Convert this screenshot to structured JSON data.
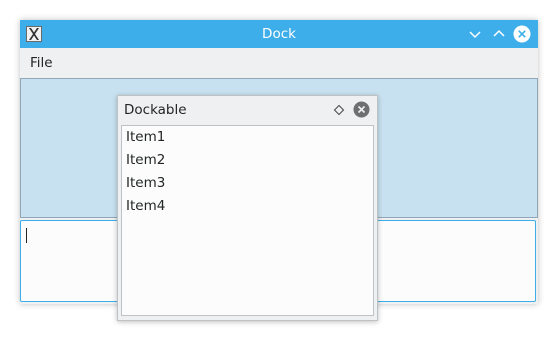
{
  "window": {
    "title": "Dock",
    "app_icon": "x11-icon",
    "controls": [
      "minimize-icon",
      "maximize-icon",
      "close-icon"
    ],
    "accent_color": "#3daee9"
  },
  "menubar": {
    "items": [
      {
        "label": "File"
      }
    ]
  },
  "dockable": {
    "title": "Dockable",
    "controls": [
      "float-icon",
      "close-icon"
    ],
    "items": [
      {
        "label": "Item1"
      },
      {
        "label": "Item2"
      },
      {
        "label": "Item3"
      },
      {
        "label": "Item4"
      }
    ]
  },
  "text_area": {
    "value": ""
  }
}
